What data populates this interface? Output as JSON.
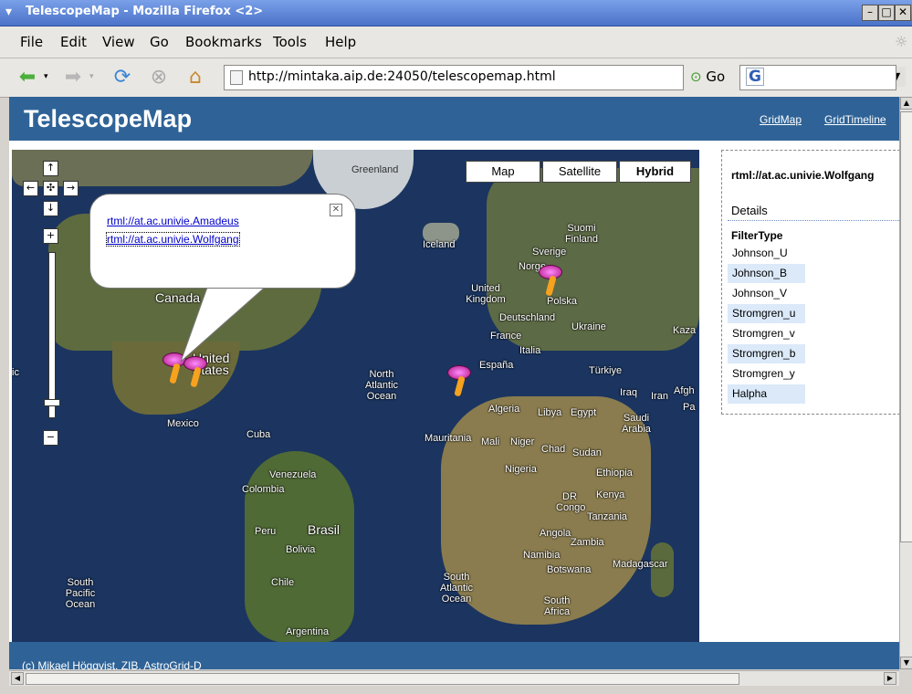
{
  "window": {
    "title": "TelescopeMap - Mozilla Firefox <2>"
  },
  "menu": [
    "File",
    "Edit",
    "View",
    "Go",
    "Bookmarks",
    "Tools",
    "Help"
  ],
  "toolbar": {
    "url": "http://mintaka.aip.de:24050/telescopemap.html",
    "go_label": "Go",
    "search_placeholder": "G"
  },
  "page": {
    "logo": "TelescopeMap",
    "links": [
      "GridMap",
      "GridTimeline"
    ],
    "map_types": [
      "Map",
      "Satellite",
      "Hybrid"
    ],
    "active_map_type": "Hybrid",
    "popup_links": [
      "rtml://at.ac.univie.Amadeus",
      "rtml://at.ac.univie.Wolfgang"
    ],
    "map_labels": {
      "greenland": "Greenland",
      "iceland": "Iceland",
      "canada": "Canada",
      "united_states": "United States",
      "mexico": "Mexico",
      "cuba": "Cuba",
      "venezuela": "Venezuela",
      "colombia": "Colombia",
      "peru": "Peru",
      "brasil": "Brasil",
      "bolivia": "Bolivia",
      "chile": "Chile",
      "argentina": "Argentina",
      "north_atlantic": "North Atlantic Ocean",
      "south_atlantic": "South Atlantic Ocean",
      "south_pacific": "South Pacific Ocean",
      "united_kingdom": "United Kingdom",
      "norge": "Norge",
      "sverige": "Sverige",
      "suomi": "Suomi Finland",
      "polska": "Polska",
      "deutschland": "Deutschland",
      "france": "France",
      "espana": "España",
      "italia": "Italia",
      "ukraine": "Ukraine",
      "turkiye": "Türkiye",
      "iraq": "Iraq",
      "iran": "Iran",
      "algeria": "Algeria",
      "libya": "Libya",
      "egypt": "Egypt",
      "saudi": "Saudi Arabia",
      "mauritania": "Mauritania",
      "mali": "Mali",
      "niger": "Niger",
      "chad": "Chad",
      "sudan": "Sudan",
      "nigeria": "Nigeria",
      "ethiopia": "Ethiopia",
      "kenya": "Kenya",
      "drcongo": "DR Congo",
      "tanzania": "Tanzania",
      "angola": "Angola",
      "zambia": "Zambia",
      "namibia": "Namibia",
      "botswana": "Botswana",
      "madagascar": "Madagascar",
      "southafrica": "South Africa",
      "afgh": "Afgh",
      "kaza": "Kaza",
      "pa": "Pa",
      "ic": "ic"
    },
    "details": {
      "title": "rtml://at.ac.univie.Wolfgang",
      "label": "Details",
      "header": "FilterType",
      "filters": [
        "Johnson_U",
        "Johnson_B",
        "Johnson_V",
        "Stromgren_u",
        "Stromgren_v",
        "Stromgren_b",
        "Stromgren_y",
        "Halpha"
      ]
    },
    "footer": "(c) Mikael Höggvist, ZIB, AstroGrid-D"
  }
}
